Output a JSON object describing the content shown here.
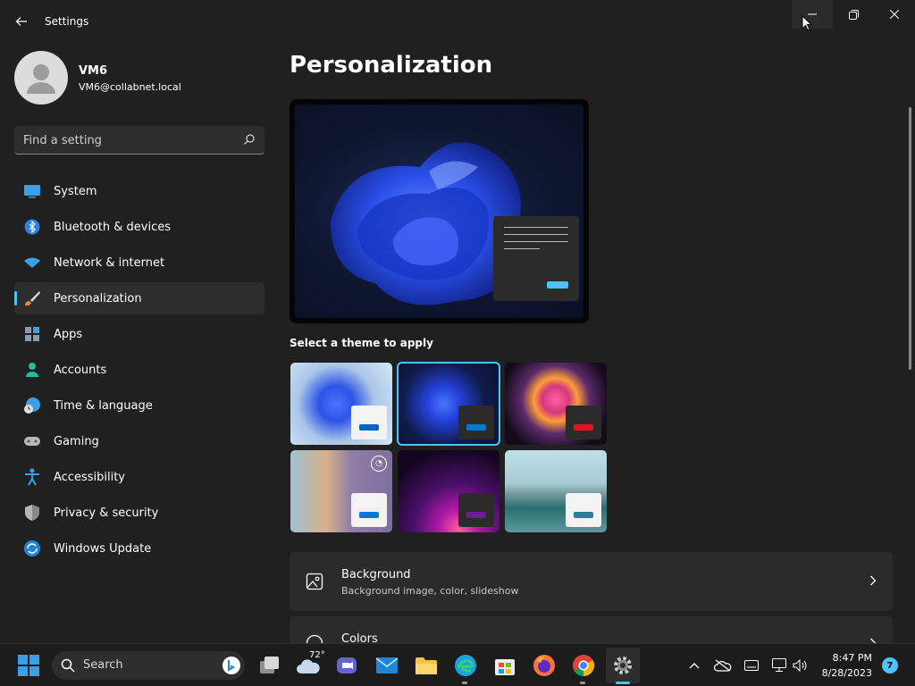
{
  "window": {
    "title": "Settings",
    "controls": [
      "minimize",
      "restore",
      "close"
    ]
  },
  "profile": {
    "name": "VM6",
    "email": "VM6@collabnet.local"
  },
  "search": {
    "placeholder": "Find a setting"
  },
  "nav": {
    "items": [
      {
        "label": "System",
        "icon": "system-icon"
      },
      {
        "label": "Bluetooth & devices",
        "icon": "bluetooth-icon"
      },
      {
        "label": "Network & internet",
        "icon": "wifi-icon"
      },
      {
        "label": "Personalization",
        "icon": "brush-icon",
        "selected": true
      },
      {
        "label": "Apps",
        "icon": "apps-icon"
      },
      {
        "label": "Accounts",
        "icon": "accounts-icon"
      },
      {
        "label": "Time & language",
        "icon": "clock-globe-icon"
      },
      {
        "label": "Gaming",
        "icon": "controller-icon"
      },
      {
        "label": "Accessibility",
        "icon": "accessibility-icon"
      },
      {
        "label": "Privacy & security",
        "icon": "shield-icon"
      },
      {
        "label": "Windows Update",
        "icon": "update-icon"
      }
    ]
  },
  "main": {
    "title": "Personalization",
    "themes_label": "Select a theme to apply",
    "themes": [
      {
        "name": "light-bloom",
        "accent": "#0067c0"
      },
      {
        "name": "dark-bloom",
        "accent": "#0078d4",
        "selected": true
      },
      {
        "name": "glow",
        "accent": "#e81123"
      },
      {
        "name": "captured-motion",
        "accent": "#0078d4"
      },
      {
        "name": "sunrise",
        "accent": "#6b1e8f"
      },
      {
        "name": "flow",
        "accent": "#2d7d9a"
      }
    ],
    "cards": [
      {
        "title": "Background",
        "subtitle": "Background image, color, slideshow",
        "icon": "image-icon"
      },
      {
        "title": "Colors",
        "subtitle": "",
        "icon": "palette-icon"
      }
    ]
  },
  "taskbar": {
    "search_label": "Search",
    "weather_temp": "72°",
    "time": "8:47 PM",
    "date": "8/28/2023",
    "notification_count": "7",
    "apps": [
      "start",
      "search",
      "task-view",
      "weather",
      "teams",
      "mail",
      "file-explorer",
      "edge",
      "store",
      "firefox",
      "chrome",
      "settings"
    ]
  },
  "colors": {
    "accent": "#4cc2ff",
    "background": "#202020",
    "card": "#2b2b2b"
  }
}
